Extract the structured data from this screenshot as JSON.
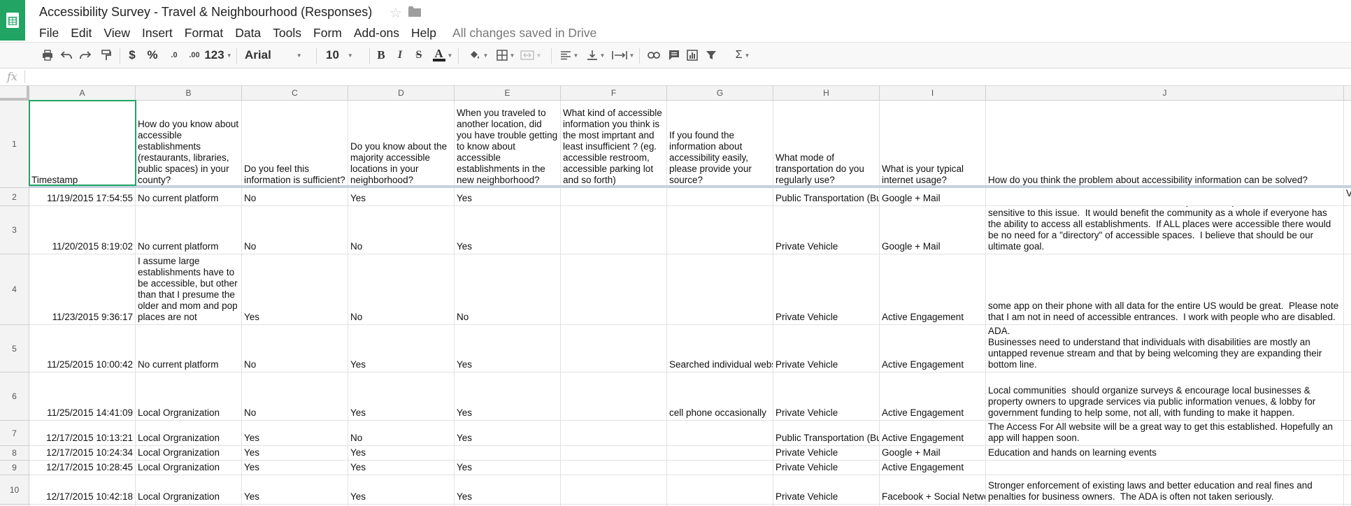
{
  "document": {
    "title": "Accessibility Survey - Travel & Neighbourhood (Responses)",
    "save_status": "All changes saved in Drive"
  },
  "menu": [
    "File",
    "Edit",
    "View",
    "Insert",
    "Format",
    "Data",
    "Tools",
    "Form",
    "Add-ons",
    "Help"
  ],
  "toolbar": {
    "currency": "$",
    "percent": "%",
    "decrease_decimal": ".0",
    "increase_decimal": ".00",
    "more_formats": "123",
    "font_family": "Arial",
    "font_size": "10",
    "bold": "B",
    "italic": "I",
    "strikethrough": "S",
    "text_color": "A",
    "functions": "Σ"
  },
  "formula_bar": {
    "label": "fx",
    "value": ""
  },
  "columns": [
    "A",
    "B",
    "C",
    "D",
    "E",
    "F",
    "G",
    "H",
    "I",
    "J"
  ],
  "rows": [
    {
      "num": "1",
      "cells": [
        "Timestamp",
        "How do you know about accessible establishments (restaurants, libraries, public spaces) in your county?",
        "Do you feel this information is sufficient?",
        "Do you know about the majority accessible locations in your neighborhood?",
        "When you traveled to another location, did you have trouble getting to know about accessible establishments in the new neighborhood?",
        "What kind of accessible information you think is the most imprtant and least insufficient ? (eg. accessible restroom, accessible parking lot and so forth)",
        "If you found the information about accessibility easily, please provide your source?",
        "What mode of transportation do you regularly use?",
        "What is your typical internet usage?",
        "How do you think the problem about accessibility information can be solved?"
      ]
    },
    {
      "num": "2",
      "cells": [
        "11/19/2015 17:54:55",
        "No current platform",
        "No",
        "Yes",
        "Yes",
        "",
        "",
        "Public Transportation (Bu",
        "Google + Mail",
        ""
      ]
    },
    {
      "num": "3",
      "cells": [
        "11/20/2015 8:19:02",
        "No current platform",
        "No",
        "No",
        "Yes",
        "",
        "",
        "Private Vehicle",
        "Google + Mail",
        "It would be wonderful if all establishments both public and private would be more sensitive to this issue.  It would benefit the community as a whole if everyone has the ability to access all establishments.  If ALL places were accessible there would be no need for a \"directory\" of accessible spaces.  I believe that should be our ultimate goal."
      ]
    },
    {
      "num": "4",
      "cells": [
        "11/23/2015 9:36:17",
        "I assume large establishments have to be accessible, but other than that I presume the older and mom and pop places are not",
        "Yes",
        "No",
        "No",
        "",
        "",
        "Private Vehicle",
        "Active Engagement",
        "some app on their phone with all data for the entire US would be great.  Please note that I am not in need of accessible entrances.  I work with people who are disabled."
      ]
    },
    {
      "num": "5",
      "cells": [
        "11/25/2015 10:00:42",
        "No current platform",
        "No",
        "Yes",
        "Yes",
        "",
        "Searched individual webs",
        "Private Vehicle",
        "Active Engagement",
        "New builds need to be enforced by the local government and the Federal government needs to make sure all funded buildings at all levels comply with the ADA.\nBusinesses need to understand that individuals with disabilities are mostly an untapped revenue stream and that by being welcoming they are expanding their bottom line."
      ]
    },
    {
      "num": "6",
      "cells": [
        "11/25/2015 14:41:09",
        "Local Orgranization",
        "No",
        "Yes",
        "Yes",
        "",
        "cell phone occasionally",
        "Private Vehicle",
        "Active Engagement",
        "Local communities  should organize surveys & encourage local businesses & property owners to upgrade services via public information venues, & lobby for government funding to help some, not all, with funding to make it happen."
      ]
    },
    {
      "num": "7",
      "cells": [
        "12/17/2015 10:13:21",
        "Local Orgranization",
        "Yes",
        "No",
        "Yes",
        "",
        "",
        "Public Transportation (Bu",
        "Active Engagement",
        "The Access For All website will be a great way to get this established. Hopefully an app will happen soon."
      ]
    },
    {
      "num": "8",
      "cells": [
        "12/17/2015 10:24:34",
        "Local Orgranization",
        "Yes",
        "Yes",
        "",
        "",
        "",
        "Private Vehicle",
        "Google + Mail",
        "Education and hands on learning events"
      ]
    },
    {
      "num": "9",
      "cells": [
        "12/17/2015 10:28:45",
        "Local Orgranization",
        "Yes",
        "Yes",
        "Yes",
        "",
        "",
        "Private Vehicle",
        "Active Engagement",
        ""
      ]
    },
    {
      "num": "10",
      "cells": [
        "12/17/2015 10:42:18",
        "Local Orgranization",
        "Yes",
        "Yes",
        "Yes",
        "",
        "",
        "Private Vehicle",
        "Facebook + Social Netwo",
        "Stronger enforcement of existing laws and better education and real fines and penalties for business owners.  The ADA is often not taken seriously."
      ]
    },
    {
      "num": "11",
      "cells": [
        "",
        "",
        "",
        "",
        "",
        "",
        "",
        "",
        "",
        ""
      ]
    }
  ],
  "row2_overflow_edge": "V",
  "colors": {
    "brand": "#21a464",
    "selection": "#21a464",
    "freeze": "#c7d1de"
  }
}
